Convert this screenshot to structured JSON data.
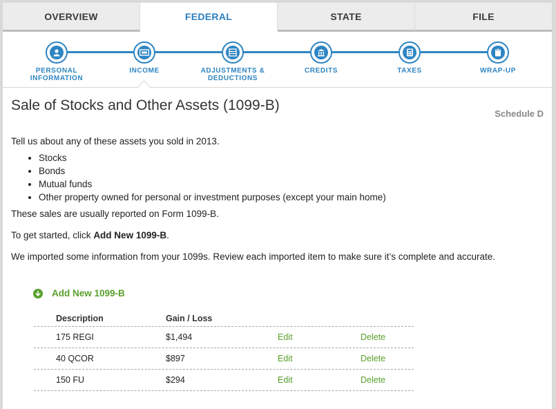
{
  "tabs": [
    {
      "label": "OVERVIEW"
    },
    {
      "label": "FEDERAL"
    },
    {
      "label": "STATE"
    },
    {
      "label": "FILE"
    }
  ],
  "steps": [
    {
      "label": "PERSONAL INFORMATION",
      "icon": "person-icon"
    },
    {
      "label": "INCOME",
      "icon": "money-icon"
    },
    {
      "label": "ADJUSTMENTS & DEDUCTIONS",
      "icon": "abacus-icon"
    },
    {
      "label": "CREDITS",
      "icon": "bank-icon"
    },
    {
      "label": "TAXES",
      "icon": "calculator-icon"
    },
    {
      "label": "WRAP-UP",
      "icon": "clipboard-icon"
    }
  ],
  "page": {
    "title": "Sale of Stocks and Other Assets (1099-B)",
    "schedule": "Schedule D",
    "intro": "Tell us about any of these assets you sold in 2013.",
    "assets": [
      "Stocks",
      "Bonds",
      "Mutual funds",
      "Other property owned for personal or investment purposes (except your main home)"
    ],
    "reported": "These sales are usually reported on Form 1099-B.",
    "get_started_prefix": "To get started, click ",
    "get_started_bold": "Add New 1099-B",
    "get_started_suffix": ".",
    "imported": "We imported some information from your 1099s. Review each imported item to make sure it’s complete and accurate."
  },
  "add_button": {
    "label": "Add New 1099-B"
  },
  "table": {
    "headers": {
      "description": "Description",
      "gain_loss": "Gain / Loss"
    },
    "rows": [
      {
        "description": "175 REGI",
        "gain_loss": "$1,494",
        "edit": "Edit",
        "delete": "Delete"
      },
      {
        "description": "40 QCOR",
        "gain_loss": "$897",
        "edit": "Edit",
        "delete": "Delete"
      },
      {
        "description": "150 FU",
        "gain_loss": "$294",
        "edit": "Edit",
        "delete": "Delete"
      }
    ]
  },
  "colors": {
    "accent_blue": "#2e85c3",
    "accent_green": "#5aa02c"
  }
}
